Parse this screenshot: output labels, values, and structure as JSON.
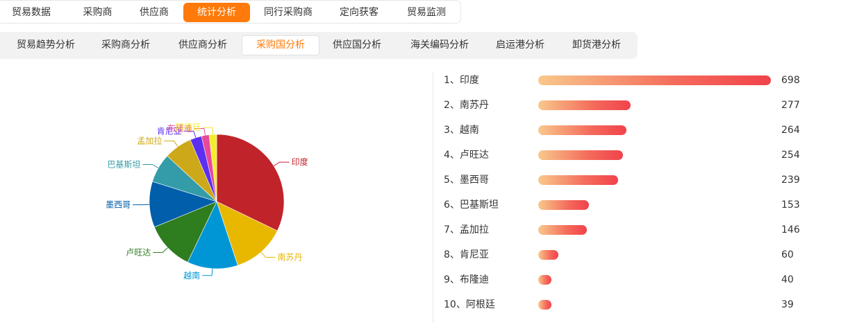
{
  "tabs_main": [
    "贸易数据",
    "采购商",
    "供应商",
    "统计分析",
    "同行采购商",
    "定向获客",
    "贸易监测"
  ],
  "tabs_main_active": 3,
  "tabs_sub": [
    "贸易趋势分析",
    "采购商分析",
    "供应商分析",
    "采购国分析",
    "供应国分析",
    "海关编码分析",
    "启运港分析",
    "卸货港分析"
  ],
  "tabs_sub_active": 3,
  "colors": {
    "accent": "#ff7a0a",
    "pie": [
      "#c1232b",
      "#e8b800",
      "#0096d6",
      "#2e7d1f",
      "#005eaa",
      "#339ca8",
      "#cda819",
      "#5b2ef0",
      "#e8489a",
      "#f4ee2a"
    ]
  },
  "ranking": [
    {
      "label": "1、印度",
      "value": "698"
    },
    {
      "label": "2、南苏丹",
      "value": "277"
    },
    {
      "label": "3、越南",
      "value": "264"
    },
    {
      "label": "4、卢旺达",
      "value": "254"
    },
    {
      "label": "5、墨西哥",
      "value": "239"
    },
    {
      "label": "6、巴基斯坦",
      "value": "153"
    },
    {
      "label": "7、孟加拉",
      "value": "146"
    },
    {
      "label": "8、肯尼亚",
      "value": "60"
    },
    {
      "label": "9、布隆迪",
      "value": "40"
    },
    {
      "label": "10、阿根廷",
      "value": "39"
    }
  ],
  "chart_data": {
    "type": "pie",
    "categories": [
      "印度",
      "南苏丹",
      "越南",
      "卢旺达",
      "墨西哥",
      "巴基斯坦",
      "孟加拉",
      "肯尼亚",
      "布隆迪",
      "阿根廷"
    ],
    "values": [
      698,
      277,
      264,
      254,
      239,
      153,
      146,
      60,
      40,
      39
    ],
    "title": "",
    "legend": "none"
  }
}
